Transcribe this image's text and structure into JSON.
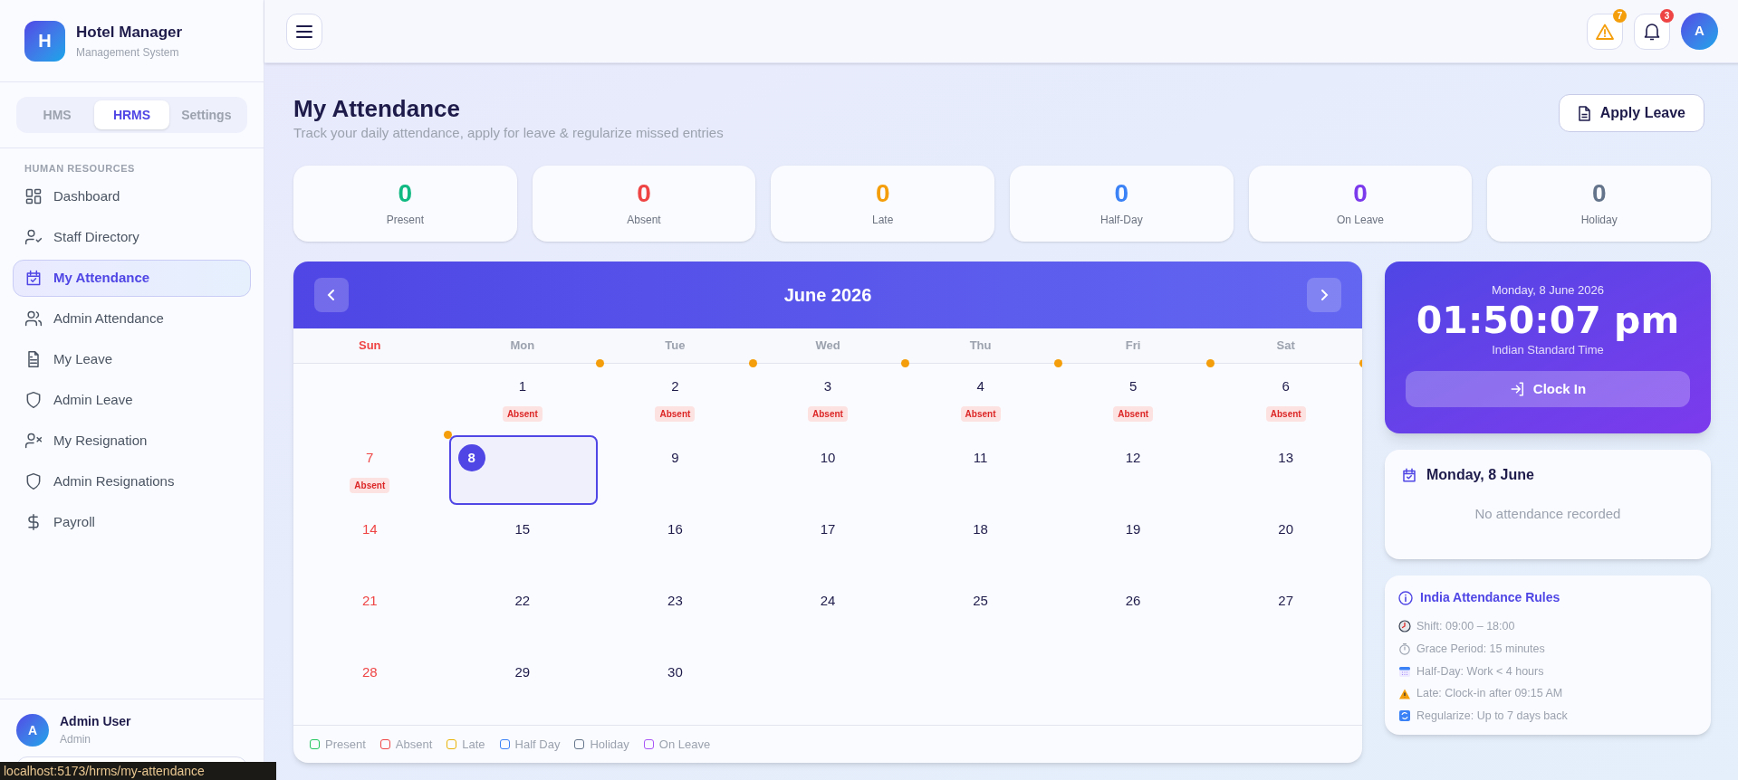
{
  "brand": {
    "logo": "H",
    "name": "Hotel Manager",
    "subtitle": "Management System"
  },
  "module_tabs": [
    {
      "label": "HMS",
      "selected": false
    },
    {
      "label": "HRMS",
      "selected": true
    },
    {
      "label": "Settings",
      "selected": false
    }
  ],
  "sidebar": {
    "section": "HUMAN RESOURCES",
    "items": [
      {
        "label": "Dashboard",
        "kind": "grid",
        "selected": false
      },
      {
        "label": "Staff Directory",
        "kind": "user-check",
        "selected": false
      },
      {
        "label": "My Attendance",
        "kind": "calendar-check",
        "selected": true
      },
      {
        "label": "Admin Attendance",
        "kind": "users",
        "selected": false
      },
      {
        "label": "My Leave",
        "kind": "file",
        "selected": false
      },
      {
        "label": "Admin Leave",
        "kind": "shield",
        "selected": false
      },
      {
        "label": "My Resignation",
        "kind": "user-x",
        "selected": false
      },
      {
        "label": "Admin Resignations",
        "kind": "shield",
        "selected": false
      },
      {
        "label": "Payroll",
        "kind": "dollar",
        "selected": false
      }
    ]
  },
  "user": {
    "avatar": "A",
    "name": "Admin User",
    "role": "Admin"
  },
  "status_url": "localhost:5173/hrms/my-attendance",
  "topbar": {
    "alerts_badge": "7",
    "notifications_badge": "3",
    "avatar": "A"
  },
  "page": {
    "title": "My Attendance",
    "subtitle": "Track your daily attendance, apply for leave & regularize missed entries",
    "action": "Apply Leave"
  },
  "stats": [
    {
      "value": "0",
      "label": "Present",
      "color": "#10b981"
    },
    {
      "value": "0",
      "label": "Absent",
      "color": "#ef4444"
    },
    {
      "value": "0",
      "label": "Late",
      "color": "#f59e0b"
    },
    {
      "value": "0",
      "label": "Half-Day",
      "color": "#3b82f6"
    },
    {
      "value": "0",
      "label": "On Leave",
      "color": "#7c3aed"
    },
    {
      "value": "0",
      "label": "Holiday",
      "color": "#64748b"
    }
  ],
  "calendar": {
    "month": "June 2026",
    "weekdays": [
      "Sun",
      "Mon",
      "Tue",
      "Wed",
      "Thu",
      "Fri",
      "Sat"
    ],
    "weeks": [
      [
        {
          "day": "1",
          "status": "Absent",
          "late": true,
          "selected": false
        },
        {
          "day": "2",
          "status": "Absent",
          "late": true,
          "selected": false
        },
        {
          "day": "3",
          "status": "Absent",
          "late": true,
          "selected": false
        },
        {
          "day": "4",
          "status": "Absent",
          "late": true,
          "selected": false
        },
        {
          "day": "5",
          "status": "Absent",
          "late": true,
          "selected": false
        },
        {
          "day": "6",
          "status": "Absent",
          "late": true,
          "selected": false
        }
      ],
      [
        {
          "day": "7",
          "status": "Absent",
          "late": true,
          "selected": false
        },
        {
          "day": "8",
          "late": false,
          "selected": true
        },
        {
          "day": "9",
          "late": false,
          "selected": false
        },
        {
          "day": "10",
          "late": false,
          "selected": false
        },
        {
          "day": "11",
          "late": false,
          "selected": false
        },
        {
          "day": "12",
          "late": false,
          "selected": false
        },
        {
          "day": "13",
          "late": false,
          "selected": false
        }
      ],
      [
        {
          "day": "14",
          "late": false,
          "selected": false
        },
        {
          "day": "15",
          "late": false,
          "selected": false
        },
        {
          "day": "16",
          "late": false,
          "selected": false
        },
        {
          "day": "17",
          "late": false,
          "selected": false
        },
        {
          "day": "18",
          "late": false,
          "selected": false
        },
        {
          "day": "19",
          "late": false,
          "selected": false
        },
        {
          "day": "20",
          "late": false,
          "selected": false
        }
      ],
      [
        {
          "day": "21",
          "late": false,
          "selected": false
        },
        {
          "day": "22",
          "late": false,
          "selected": false
        },
        {
          "day": "23",
          "late": false,
          "selected": false
        },
        {
          "day": "24",
          "late": false,
          "selected": false
        },
        {
          "day": "25",
          "late": false,
          "selected": false
        },
        {
          "day": "26",
          "late": false,
          "selected": false
        },
        {
          "day": "27",
          "late": false,
          "selected": false
        }
      ],
      [
        {
          "day": "28",
          "late": false,
          "selected": false
        },
        {
          "day": "29",
          "late": false,
          "selected": false
        },
        {
          "day": "30",
          "late": false,
          "selected": false
        }
      ]
    ],
    "legend": [
      {
        "label": "Present",
        "color": "#22c55e"
      },
      {
        "label": "Absent",
        "color": "#ef4444"
      },
      {
        "label": "Late",
        "color": "#eab308"
      },
      {
        "label": "Half Day",
        "color": "#3b82f6"
      },
      {
        "label": "Holiday",
        "color": "#64748b"
      },
      {
        "label": "On Leave",
        "color": "#a855f7"
      }
    ]
  },
  "clock": {
    "date": "Monday, 8 June 2026",
    "time": "01:50:07 pm",
    "zone": "Indian Standard Time",
    "action": "Clock In"
  },
  "day_panel": {
    "title": "Monday, 8 June",
    "message": "No attendance recorded"
  },
  "rules": {
    "title": "India Attendance Rules",
    "items": [
      {
        "kind": "clock",
        "text": "Shift: 09:00 – 18:00"
      },
      {
        "kind": "stopwatch",
        "text": "Grace Period: 15 minutes"
      },
      {
        "kind": "calendar",
        "text": "Half-Day: Work < 4 hours"
      },
      {
        "kind": "warning",
        "text": "Late: Clock-in after 09:15 AM"
      },
      {
        "kind": "refresh",
        "text": "Regularize: Up to 7 days back"
      }
    ]
  }
}
